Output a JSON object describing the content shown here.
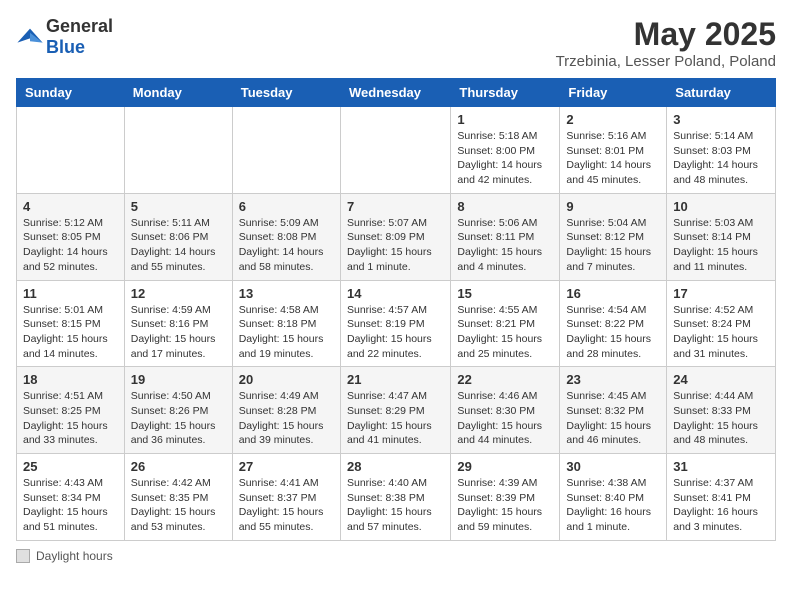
{
  "app": {
    "name_general": "General",
    "name_blue": "Blue"
  },
  "calendar": {
    "title": "May 2025",
    "subtitle": "Trzebinia, Lesser Poland, Poland",
    "days_of_week": [
      "Sunday",
      "Monday",
      "Tuesday",
      "Wednesday",
      "Thursday",
      "Friday",
      "Saturday"
    ],
    "weeks": [
      [
        {
          "day": "",
          "info": ""
        },
        {
          "day": "",
          "info": ""
        },
        {
          "day": "",
          "info": ""
        },
        {
          "day": "",
          "info": ""
        },
        {
          "day": "1",
          "info": "Sunrise: 5:18 AM\nSunset: 8:00 PM\nDaylight: 14 hours and 42 minutes."
        },
        {
          "day": "2",
          "info": "Sunrise: 5:16 AM\nSunset: 8:01 PM\nDaylight: 14 hours and 45 minutes."
        },
        {
          "day": "3",
          "info": "Sunrise: 5:14 AM\nSunset: 8:03 PM\nDaylight: 14 hours and 48 minutes."
        }
      ],
      [
        {
          "day": "4",
          "info": "Sunrise: 5:12 AM\nSunset: 8:05 PM\nDaylight: 14 hours and 52 minutes."
        },
        {
          "day": "5",
          "info": "Sunrise: 5:11 AM\nSunset: 8:06 PM\nDaylight: 14 hours and 55 minutes."
        },
        {
          "day": "6",
          "info": "Sunrise: 5:09 AM\nSunset: 8:08 PM\nDaylight: 14 hours and 58 minutes."
        },
        {
          "day": "7",
          "info": "Sunrise: 5:07 AM\nSunset: 8:09 PM\nDaylight: 15 hours and 1 minute."
        },
        {
          "day": "8",
          "info": "Sunrise: 5:06 AM\nSunset: 8:11 PM\nDaylight: 15 hours and 4 minutes."
        },
        {
          "day": "9",
          "info": "Sunrise: 5:04 AM\nSunset: 8:12 PM\nDaylight: 15 hours and 7 minutes."
        },
        {
          "day": "10",
          "info": "Sunrise: 5:03 AM\nSunset: 8:14 PM\nDaylight: 15 hours and 11 minutes."
        }
      ],
      [
        {
          "day": "11",
          "info": "Sunrise: 5:01 AM\nSunset: 8:15 PM\nDaylight: 15 hours and 14 minutes."
        },
        {
          "day": "12",
          "info": "Sunrise: 4:59 AM\nSunset: 8:16 PM\nDaylight: 15 hours and 17 minutes."
        },
        {
          "day": "13",
          "info": "Sunrise: 4:58 AM\nSunset: 8:18 PM\nDaylight: 15 hours and 19 minutes."
        },
        {
          "day": "14",
          "info": "Sunrise: 4:57 AM\nSunset: 8:19 PM\nDaylight: 15 hours and 22 minutes."
        },
        {
          "day": "15",
          "info": "Sunrise: 4:55 AM\nSunset: 8:21 PM\nDaylight: 15 hours and 25 minutes."
        },
        {
          "day": "16",
          "info": "Sunrise: 4:54 AM\nSunset: 8:22 PM\nDaylight: 15 hours and 28 minutes."
        },
        {
          "day": "17",
          "info": "Sunrise: 4:52 AM\nSunset: 8:24 PM\nDaylight: 15 hours and 31 minutes."
        }
      ],
      [
        {
          "day": "18",
          "info": "Sunrise: 4:51 AM\nSunset: 8:25 PM\nDaylight: 15 hours and 33 minutes."
        },
        {
          "day": "19",
          "info": "Sunrise: 4:50 AM\nSunset: 8:26 PM\nDaylight: 15 hours and 36 minutes."
        },
        {
          "day": "20",
          "info": "Sunrise: 4:49 AM\nSunset: 8:28 PM\nDaylight: 15 hours and 39 minutes."
        },
        {
          "day": "21",
          "info": "Sunrise: 4:47 AM\nSunset: 8:29 PM\nDaylight: 15 hours and 41 minutes."
        },
        {
          "day": "22",
          "info": "Sunrise: 4:46 AM\nSunset: 8:30 PM\nDaylight: 15 hours and 44 minutes."
        },
        {
          "day": "23",
          "info": "Sunrise: 4:45 AM\nSunset: 8:32 PM\nDaylight: 15 hours and 46 minutes."
        },
        {
          "day": "24",
          "info": "Sunrise: 4:44 AM\nSunset: 8:33 PM\nDaylight: 15 hours and 48 minutes."
        }
      ],
      [
        {
          "day": "25",
          "info": "Sunrise: 4:43 AM\nSunset: 8:34 PM\nDaylight: 15 hours and 51 minutes."
        },
        {
          "day": "26",
          "info": "Sunrise: 4:42 AM\nSunset: 8:35 PM\nDaylight: 15 hours and 53 minutes."
        },
        {
          "day": "27",
          "info": "Sunrise: 4:41 AM\nSunset: 8:37 PM\nDaylight: 15 hours and 55 minutes."
        },
        {
          "day": "28",
          "info": "Sunrise: 4:40 AM\nSunset: 8:38 PM\nDaylight: 15 hours and 57 minutes."
        },
        {
          "day": "29",
          "info": "Sunrise: 4:39 AM\nSunset: 8:39 PM\nDaylight: 15 hours and 59 minutes."
        },
        {
          "day": "30",
          "info": "Sunrise: 4:38 AM\nSunset: 8:40 PM\nDaylight: 16 hours and 1 minute."
        },
        {
          "day": "31",
          "info": "Sunrise: 4:37 AM\nSunset: 8:41 PM\nDaylight: 16 hours and 3 minutes."
        }
      ]
    ]
  },
  "footer": {
    "legend_label": "Daylight hours"
  }
}
